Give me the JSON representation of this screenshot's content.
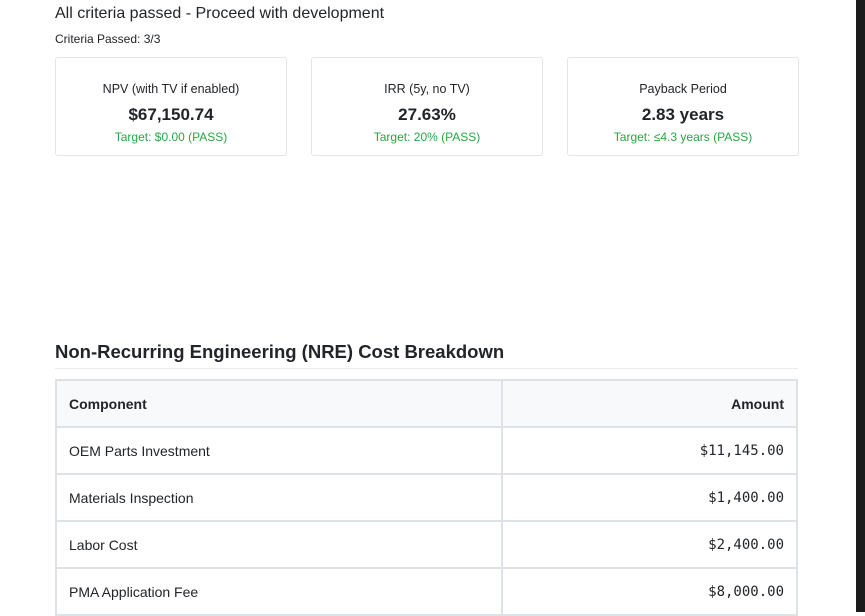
{
  "status": {
    "message": "All criteria passed - Proceed with development",
    "criteria_passed": "Criteria Passed: 3/3"
  },
  "metrics": [
    {
      "label": "NPV (with TV if enabled)",
      "value": "$67,150.74",
      "target": "Target: $0.00 (PASS)"
    },
    {
      "label": "IRR (5y, no TV)",
      "value": "27.63%",
      "target": "Target: 20% (PASS)"
    },
    {
      "label": "Payback Period",
      "value": "2.83 years",
      "target": "Target: ≤4.3 years (PASS)"
    }
  ],
  "colors": {
    "pass": "#28a745",
    "border": "#dee2e6",
    "scrollbar": "#1b1b1b"
  },
  "nre": {
    "title": "Non-Recurring Engineering (NRE) Cost Breakdown",
    "headers": {
      "component": "Component",
      "amount": "Amount"
    },
    "rows": [
      {
        "component": "OEM Parts Investment",
        "amount": "$11,145.00"
      },
      {
        "component": "Materials Inspection",
        "amount": "$1,400.00"
      },
      {
        "component": "Labor Cost",
        "amount": "$2,400.00"
      },
      {
        "component": "PMA Application Fee",
        "amount": "$8,000.00"
      }
    ]
  }
}
